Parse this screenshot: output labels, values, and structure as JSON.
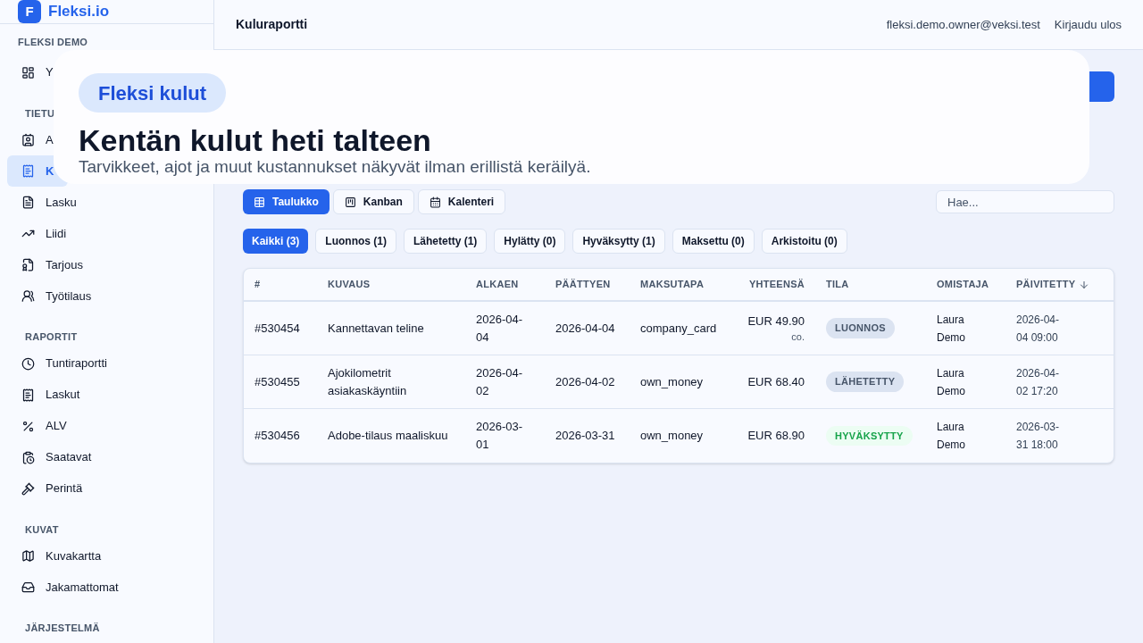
{
  "brand": {
    "logo": "F",
    "name": "Fleksi.io"
  },
  "sidebar": {
    "workspace": "FLEKSI DEMO",
    "sections": [
      {
        "items": [
          {
            "label": "Y",
            "selected": false
          }
        ]
      },
      {
        "title": "TIETU",
        "items": [
          {
            "label": "A",
            "selected": false
          },
          {
            "label": "K",
            "selected": true
          },
          {
            "label": "Lasku",
            "selected": false
          },
          {
            "label": "Liidi",
            "selected": false
          },
          {
            "label": "Tarjous",
            "selected": false
          },
          {
            "label": "Työtilaus",
            "selected": false
          }
        ]
      },
      {
        "title": "RAPORTIT",
        "items": [
          {
            "label": "Tuntiraportti",
            "selected": false
          },
          {
            "label": "Laskut",
            "selected": false
          },
          {
            "label": "ALV",
            "selected": false
          },
          {
            "label": "Saatavat",
            "selected": false
          },
          {
            "label": "Perintä",
            "selected": false
          }
        ]
      },
      {
        "title": "KUVAT",
        "items": [
          {
            "label": "Kuvakartta",
            "selected": false
          },
          {
            "label": "Jakamattomat",
            "selected": false
          }
        ]
      },
      {
        "title": "JÄRJESTELMÄ"
      }
    ]
  },
  "header": {
    "title": "Kuluraportti",
    "user": "fleksi.demo.owner@veksi.test",
    "logout": "Kirjaudu ulos"
  },
  "views": [
    {
      "label": "Taulukko",
      "selected": true
    },
    {
      "label": "Kanban",
      "selected": false
    },
    {
      "label": "Kalenteri",
      "selected": false
    }
  ],
  "search": {
    "placeholder": "Hae..."
  },
  "filters": [
    {
      "label": "Kaikki (3)",
      "selected": true
    },
    {
      "label": "Luonnos (1)",
      "selected": false
    },
    {
      "label": "Lähetetty (1)",
      "selected": false
    },
    {
      "label": "Hylätty (0)",
      "selected": false
    },
    {
      "label": "Hyväksytty (1)",
      "selected": false
    },
    {
      "label": "Maksettu (0)",
      "selected": false
    },
    {
      "label": "Arkistoitu (0)",
      "selected": false
    }
  ],
  "table": {
    "columns": [
      "#",
      "KUVAUS",
      "ALKAEN",
      "PÄÄTTYEN",
      "MAKSUTAPA",
      "YHTEENSÄ",
      "TILA",
      "OMISTAJA",
      "PÄIVITETTY"
    ],
    "rows": [
      {
        "id": "#530454",
        "description": "Kannettavan teline",
        "start": "2026-04-04",
        "end": "2026-04-04",
        "payment": "company_card",
        "total": "EUR 49.90",
        "total_note": "co.",
        "status": "LUONNOS",
        "kind": "neutral",
        "owner": "Laura Demo",
        "updated": "2026-04-04 09:00"
      },
      {
        "id": "#530455",
        "description": "Ajokilometrit asiakaskäyntiin",
        "start": "2026-04-02",
        "end": "2026-04-02",
        "payment": "own_money",
        "total": "EUR 68.40",
        "status": "LÄHETETTY",
        "kind": "neutral",
        "owner": "Laura Demo",
        "updated": "2026-04-02 17:20"
      },
      {
        "id": "#530456",
        "description": "Adobe-tilaus maaliskuu",
        "start": "2026-03-01",
        "end": "2026-03-31",
        "payment": "own_money",
        "total": "EUR 68.90",
        "status": "HYVÄKSYTTY",
        "kind": "success",
        "owner": "Laura Demo",
        "updated": "2026-03-31 18:00"
      }
    ]
  },
  "banner": {
    "badge": "Fleksi kulut",
    "headline": "Kentän kulut heti talteen",
    "subtitle": "Tarvikkeet, ajot ja muut kustannukset näkyvät ilman erillistä keräilyä."
  }
}
